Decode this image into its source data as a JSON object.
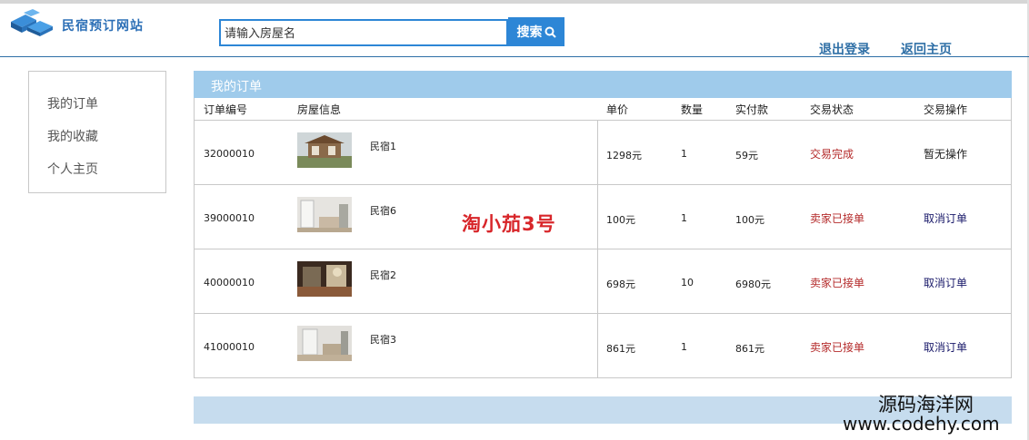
{
  "header": {
    "logo_text": "民宿预订网站",
    "search_placeholder": "请输入房屋名",
    "search_label": "搜索",
    "logout_label": "退出登录",
    "home_label": "返回主页"
  },
  "sidebar": {
    "items": [
      {
        "label": "我的订单"
      },
      {
        "label": "我的收藏"
      },
      {
        "label": "个人主页"
      }
    ]
  },
  "main": {
    "title": "我的订单",
    "columns": [
      "订单编号",
      "房屋信息",
      "单价",
      "数量",
      "实付款",
      "交易状态",
      "交易操作"
    ],
    "orders": [
      {
        "id": "32000010",
        "house": "民宿1",
        "price": "1298元",
        "qty": "1",
        "paid": "59元",
        "status": "交易完成",
        "action": "暂无操作"
      },
      {
        "id": "39000010",
        "house": "民宿6",
        "price": "100元",
        "qty": "1",
        "paid": "100元",
        "status": "卖家已接单",
        "action": "取消订单"
      },
      {
        "id": "40000010",
        "house": "民宿2",
        "price": "698元",
        "qty": "10",
        "paid": "6980元",
        "status": "卖家已接单",
        "action": "取消订单"
      },
      {
        "id": "41000010",
        "house": "民宿3",
        "price": "861元",
        "qty": "1",
        "paid": "861元",
        "status": "卖家已接单",
        "action": "取消订单"
      }
    ]
  },
  "watermarks": {
    "center": "淘小茄3号",
    "site_cn": "源码海洋网",
    "site_en": "www.codehy.com"
  },
  "colors": {
    "accent": "#2d86d6",
    "header_bar": "#9fcbeb",
    "status_red": "#b42a2a",
    "link_blue": "#2f6fa6"
  }
}
